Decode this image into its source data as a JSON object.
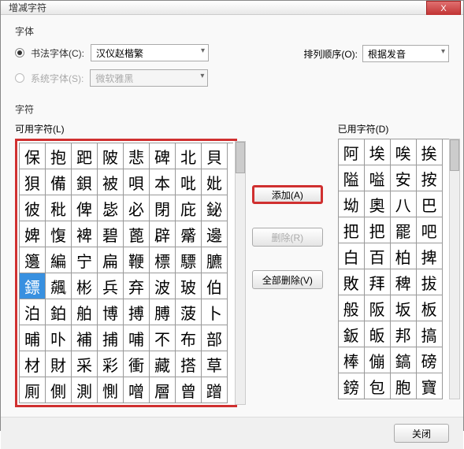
{
  "window": {
    "title": "增减字符"
  },
  "font_section": {
    "label": "字体",
    "calligraphy_radio": "书法字体(C):",
    "system_radio": "系统字体(S):",
    "calligraphy_value": "汉仪赵楷繁",
    "system_value": "微软雅黑",
    "sort_label": "排列顺序(O):",
    "sort_value": "根据发音"
  },
  "char_section": {
    "label": "字符",
    "available_label": "可用字符(L)",
    "used_label": "已用字符(D)"
  },
  "buttons": {
    "add": "添加(A)",
    "remove": "删除(R)",
    "remove_all": "全部删除(V)",
    "close": "关闭"
  },
  "close_x": "X",
  "left_chars": [
    "保",
    "抱",
    "跁",
    "陂",
    "悲",
    "碑",
    "北",
    "貝",
    "狽",
    "備",
    "鋇",
    "被",
    "唄",
    "本",
    "吡",
    "妣",
    "彼",
    "秕",
    "俾",
    "毖",
    "必",
    "閉",
    "庇",
    "鉍",
    "婢",
    "愎",
    "裨",
    "碧",
    "蓖",
    "辟",
    "觱",
    "邊",
    "籩",
    "編",
    "宁",
    "扁",
    "鞭",
    "標",
    "驃",
    "臕",
    "鏢",
    "飆",
    "彬",
    "兵",
    "弃",
    "波",
    "玻",
    "伯",
    "泊",
    "鉑",
    "舶",
    "博",
    "搏",
    "膊",
    "菠",
    "卜",
    "晡",
    "卟",
    "補",
    "捕",
    "哺",
    "不",
    "布",
    "部",
    "材",
    "財",
    "采",
    "彩",
    "衝",
    "藏",
    "搭",
    "草",
    "厠",
    "側",
    "測",
    "惻",
    "噌",
    "層",
    "曾",
    "蹭"
  ],
  "selected_left_index": 40,
  "right_chars": [
    "阿",
    "埃",
    "唉",
    "挨",
    "隘",
    "嗌",
    "安",
    "按",
    "坳",
    "奧",
    "八",
    "巴",
    "把",
    "把",
    "罷",
    "吧",
    "白",
    "百",
    "柏",
    "捭",
    "敗",
    "拜",
    "稗",
    "拔",
    "般",
    "阪",
    "坂",
    "板",
    "鈑",
    "皈",
    "邦",
    "搞",
    "",
    "棒",
    "傰",
    "鎬",
    "磅",
    "",
    "鎊",
    "包",
    "胞",
    "寶"
  ]
}
